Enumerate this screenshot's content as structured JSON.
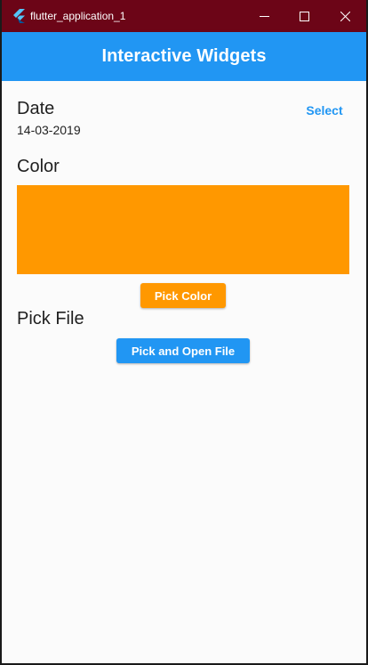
{
  "window": {
    "title": "flutter_application_1",
    "titlebar_color": "#6c0517",
    "controls": [
      "minimize-icon",
      "maximize-icon",
      "close-icon"
    ]
  },
  "appbar": {
    "title": "Interactive Widgets",
    "color": "#2196f3"
  },
  "date_section": {
    "title": "Date",
    "value": "14-03-2019",
    "select_label": "Select"
  },
  "color_section": {
    "title": "Color",
    "swatch_color": "#ff9800",
    "button_label": "Pick Color"
  },
  "file_section": {
    "title": "Pick File",
    "button_label": "Pick and Open File"
  }
}
